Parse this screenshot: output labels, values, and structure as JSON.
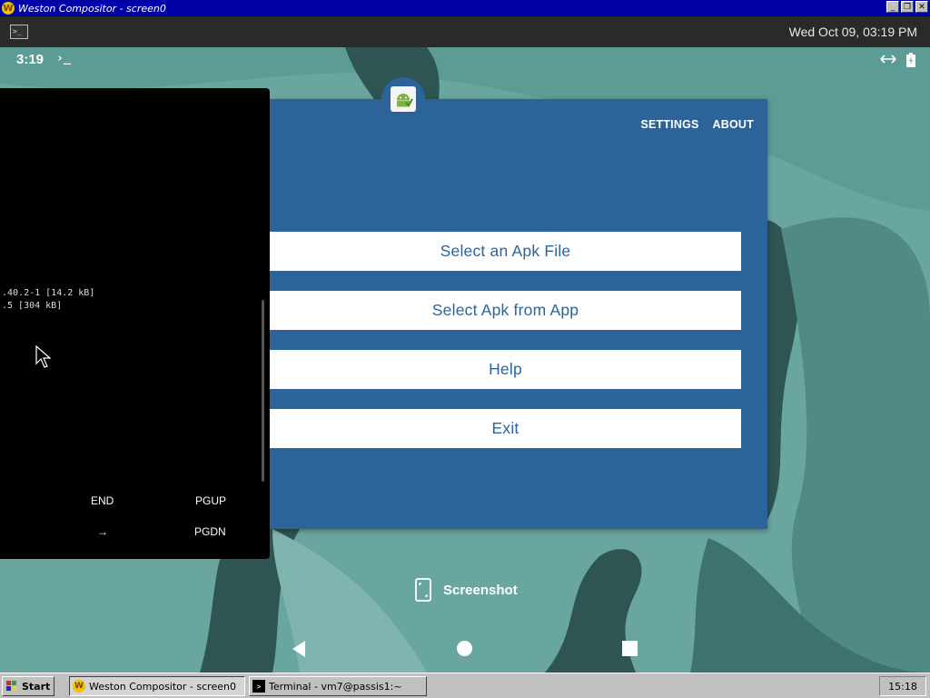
{
  "host_window": {
    "title": "Weston Compositor - screen0",
    "icon": "weston-w-icon"
  },
  "weston_panel": {
    "launcher_icon": "terminal-launcher-icon",
    "clock": "Wed Oct 09, 03:19 PM"
  },
  "android_status": {
    "time": "3:19",
    "prompt": "›_",
    "icons": [
      "data-sync-icon",
      "battery-icon"
    ]
  },
  "terminal": {
    "lines": [
      ".40.2-1 [14.2 kB]",
      ".5 [304 kB]"
    ],
    "keys": {
      "end": "END",
      "pgup": "PGUP",
      "right": "→",
      "pgdn": "PGDN"
    }
  },
  "app": {
    "header_links": [
      "SETTINGS",
      "ABOUT"
    ],
    "buttons": [
      "Select an Apk File",
      "Select Apk from App",
      "Help",
      "Exit"
    ]
  },
  "screenshot": {
    "label": "Screenshot"
  },
  "taskbar": {
    "start_label": "Start",
    "tasks": [
      "Weston Compositor - screen0",
      "Terminal - vm7@passis1:~"
    ],
    "clock": "15:18"
  },
  "colors": {
    "app_blue": "#2c6499",
    "wallpaper_teal": "#6aa6a0",
    "wallpaper_dark": "#2f5553",
    "host_title": "#0000a8"
  }
}
